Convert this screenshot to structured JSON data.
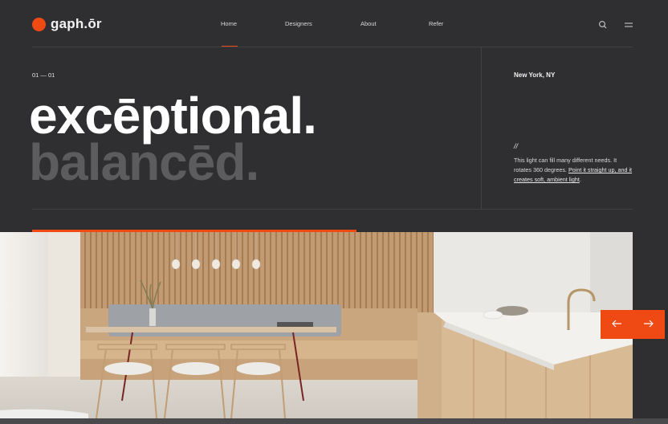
{
  "brand": {
    "name": "gaph.ōr",
    "accent": "#f04a14"
  },
  "nav": {
    "items": [
      {
        "label": "Home",
        "active": true
      },
      {
        "label": "Designers",
        "active": false
      },
      {
        "label": "About",
        "active": false
      },
      {
        "label": "Refer",
        "active": false
      }
    ]
  },
  "icons": {
    "search": "search-icon",
    "menu": "menu-icon",
    "prev": "arrow-left-icon",
    "next": "arrow-right-icon"
  },
  "hero": {
    "counter": "01 — 01",
    "location": "New York, NY",
    "headline_primary": "excēptional.",
    "headline_secondary": "balancēd.",
    "slash": "//",
    "description_plain": "This light can fill many different needs. It rotates 360 degrees. ",
    "description_link": "Point it straight up, and it creates soft, ambient light",
    "description_end": ".",
    "progress": 0.54
  },
  "image": {
    "description_name": "kitchen-dining-photo"
  }
}
